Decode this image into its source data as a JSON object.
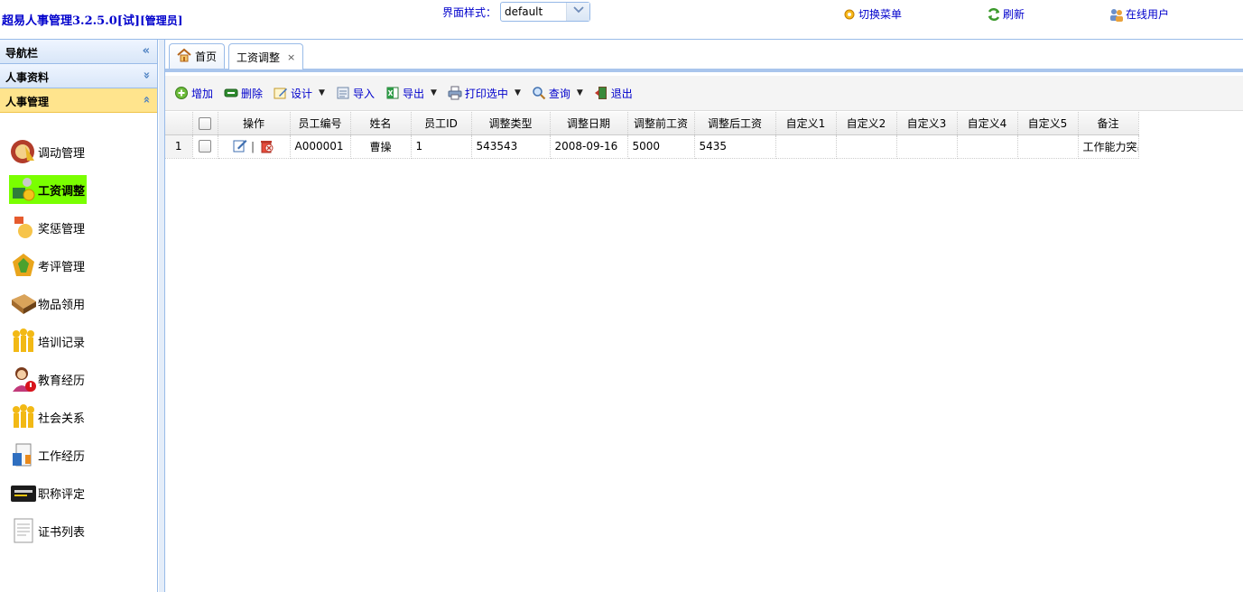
{
  "header": {
    "app_title": "超易人事管理3.2.5.0[试]",
    "role": "[管理员]",
    "style_label": "界面样式：",
    "style_value": "default",
    "switch_menu": "切换菜单",
    "refresh": "刷新",
    "online_users": "在线用户"
  },
  "sidebar": {
    "panels": [
      {
        "label": "导航栏",
        "toggle": "«"
      },
      {
        "label": "人事资料",
        "toggle": "»"
      },
      {
        "label": "人事管理",
        "toggle": "«"
      }
    ],
    "items": [
      {
        "label": "调动管理",
        "icon": "transfer-icon"
      },
      {
        "label": "工资调整",
        "icon": "salary-icon",
        "selected": true
      },
      {
        "label": "奖惩管理",
        "icon": "reward-icon"
      },
      {
        "label": "考评管理",
        "icon": "evaluation-icon"
      },
      {
        "label": "物品领用",
        "icon": "goods-icon"
      },
      {
        "label": "培训记录",
        "icon": "training-icon"
      },
      {
        "label": "教育经历",
        "icon": "education-icon"
      },
      {
        "label": "社会关系",
        "icon": "relations-icon"
      },
      {
        "label": "工作经历",
        "icon": "work-history-icon"
      },
      {
        "label": "职称评定",
        "icon": "title-icon"
      },
      {
        "label": "证书列表",
        "icon": "certificate-icon"
      }
    ]
  },
  "tabs": [
    {
      "label": "首页",
      "icon": "home-icon"
    },
    {
      "label": "工资调整",
      "close": "×",
      "active": true
    }
  ],
  "toolbar": {
    "add": "增加",
    "delete": "删除",
    "design": "设计",
    "import": "导入",
    "export": "导出",
    "print": "打印选中",
    "query": "查询",
    "exit": "退出"
  },
  "grid": {
    "columns": [
      "操作",
      "员工编号",
      "姓名",
      "员工ID",
      "调整类型",
      "调整日期",
      "调整前工资",
      "调整后工资",
      "自定义1",
      "自定义2",
      "自定义3",
      "自定义4",
      "自定义5",
      "备注"
    ],
    "rows": [
      {
        "rownum": "1",
        "emp_no": "A000001",
        "name": "曹操",
        "emp_id": "1",
        "type": "543543",
        "date": "2008-09-16",
        "before": "5000",
        "after": "5435",
        "c1": "",
        "c2": "",
        "c3": "",
        "c4": "",
        "c5": "",
        "remark": "工作能力突出"
      }
    ]
  },
  "colors": {
    "link": "#0000cc",
    "border": "#99bbe8",
    "selected_item": "#7aff00",
    "active_panel": "#ffe48d"
  }
}
